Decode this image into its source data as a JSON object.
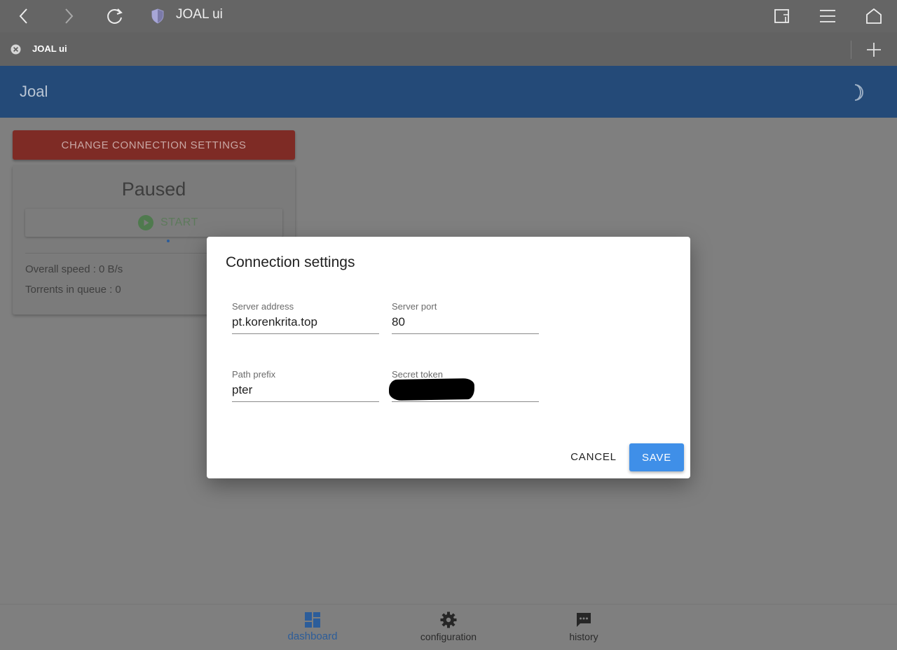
{
  "browser": {
    "page_title": "JOAL ui",
    "tab_title": "JOAL ui"
  },
  "app": {
    "title": "Joal",
    "change_connection_label": "CHANGE CONNECTION SETTINGS",
    "status": {
      "title": "Paused",
      "start_label": "START",
      "overall_speed": "Overall speed : 0 B/s",
      "torrents_in_queue": "Torrents in queue : 0"
    }
  },
  "dialog": {
    "title": "Connection settings",
    "fields": [
      {
        "label": "Server address",
        "value": "pt.korenkrita.top"
      },
      {
        "label": "Server port",
        "value": "80"
      },
      {
        "label": "Path prefix",
        "value": "pter"
      },
      {
        "label": "Secret token",
        "value": ""
      }
    ],
    "cancel_label": "CANCEL",
    "save_label": "SAVE"
  },
  "bottom_nav": {
    "items": [
      {
        "label": "dashboard",
        "icon": "dashboard-icon",
        "active": true
      },
      {
        "label": "configuration",
        "icon": "gear-icon",
        "active": false
      },
      {
        "label": "history",
        "icon": "chat-icon",
        "active": false
      }
    ]
  },
  "colors": {
    "app_bar": "#244a78",
    "danger_button": "#7e2b25",
    "primary_button": "#3f8fe8",
    "active_nav": "#2c5d9a"
  }
}
